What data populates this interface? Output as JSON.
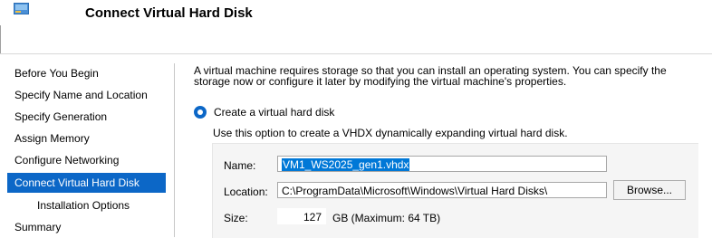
{
  "header": {
    "title": "Connect Virtual Hard Disk",
    "icon": "virtual-disk-icon"
  },
  "nav": {
    "items": [
      {
        "label": "Before You Begin"
      },
      {
        "label": "Specify Name and Location"
      },
      {
        "label": "Specify Generation"
      },
      {
        "label": "Assign Memory"
      },
      {
        "label": "Configure Networking"
      },
      {
        "label": "Connect Virtual Hard Disk"
      },
      {
        "label": "Installation Options"
      },
      {
        "label": "Summary"
      }
    ],
    "selected_index": 5,
    "selected_color": "#0c67c7"
  },
  "content": {
    "description_line1": "A virtual machine requires storage so that you can install an operating system. You can specify the",
    "description_line2": "storage now or configure it later by modifying the virtual machine's properties.",
    "option_label": "Create a virtual hard disk",
    "option_description": "Use this option to create a VHDX dynamically expanding virtual hard disk.",
    "name_label": "Name:",
    "name_value": "VM1_WS2025_gen1.vhdx",
    "location_label": "Location:",
    "location_value": "C:\\ProgramData\\Microsoft\\Windows\\Virtual Hard Disks\\",
    "browse_label": "Browse...",
    "size_label": "Size:",
    "size_value": "127",
    "size_unit": "GB (Maximum: 64 TB)"
  }
}
